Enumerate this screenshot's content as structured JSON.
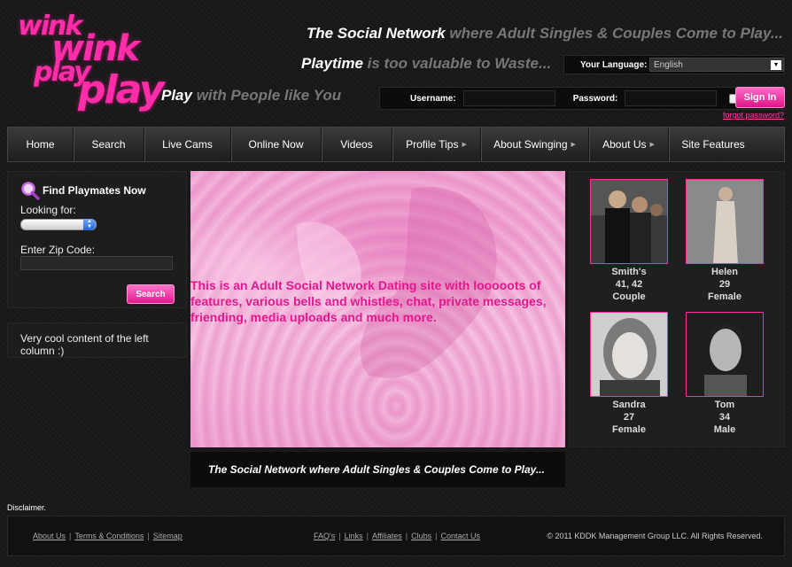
{
  "logo": {
    "line1": "wink",
    "line2": "wink",
    "line3": "play",
    "line4": "play"
  },
  "taglines": {
    "t1_highlight": "The Social Network",
    "t1_rest": " where Adult Singles & Couples Come to Play...",
    "t2_highlight": "Playtime",
    "t2_rest": " is too valuable to Waste...",
    "t3_highlight": "Play",
    "t3_rest": " with People like You"
  },
  "language": {
    "label": "Your Language:",
    "value": "English"
  },
  "login": {
    "username_label": "Username:",
    "password_label": "Password:",
    "signin_label": "Sign In",
    "forgot_label": "forgot password?"
  },
  "nav": [
    {
      "label": "Home",
      "has_sub": false
    },
    {
      "label": "Search",
      "has_sub": false
    },
    {
      "label": "Live Cams",
      "has_sub": false
    },
    {
      "label": "Online Now",
      "has_sub": false
    },
    {
      "label": "Videos",
      "has_sub": false
    },
    {
      "label": "Profile Tips",
      "has_sub": true
    },
    {
      "label": "About Swinging",
      "has_sub": true
    },
    {
      "label": "About Us",
      "has_sub": true
    },
    {
      "label": "Site Features",
      "has_sub": false
    }
  ],
  "search_panel": {
    "title": "Find Playmates Now",
    "looking_for_label": "Looking for:",
    "zip_label": "Enter Zip Code:",
    "search_button": "Search"
  },
  "left_content": {
    "text": "Very cool content of the left column :)"
  },
  "hero": {
    "text": "This is an Adult Social Network Dating site with looooots of features, various bells and whistles, chat, private messages, friending, media uploads and much more."
  },
  "caption": {
    "text": "The Social Network where Adult Singles & Couples Come to Play..."
  },
  "members": [
    {
      "name": "Smith's",
      "age": "41, 42",
      "type": "Couple"
    },
    {
      "name": "Helen",
      "age": "29",
      "type": "Female"
    },
    {
      "name": "Sandra",
      "age": "27",
      "type": "Female"
    },
    {
      "name": "Tom",
      "age": "34",
      "type": "Male"
    }
  ],
  "footer": {
    "disclaimer": "Disclaimer.",
    "left_links": [
      "About Us",
      "Terms & Conditions",
      "Sitemap"
    ],
    "mid_links": [
      "FAQ's",
      "Links",
      "Affiliates",
      "Clubs",
      "Contact Us"
    ],
    "copyright": "© 2011 KDDK Management Group LLC. All Rights Reserved."
  },
  "colors": {
    "accent": "#ff2ea8",
    "background": "#1a1a1a"
  }
}
